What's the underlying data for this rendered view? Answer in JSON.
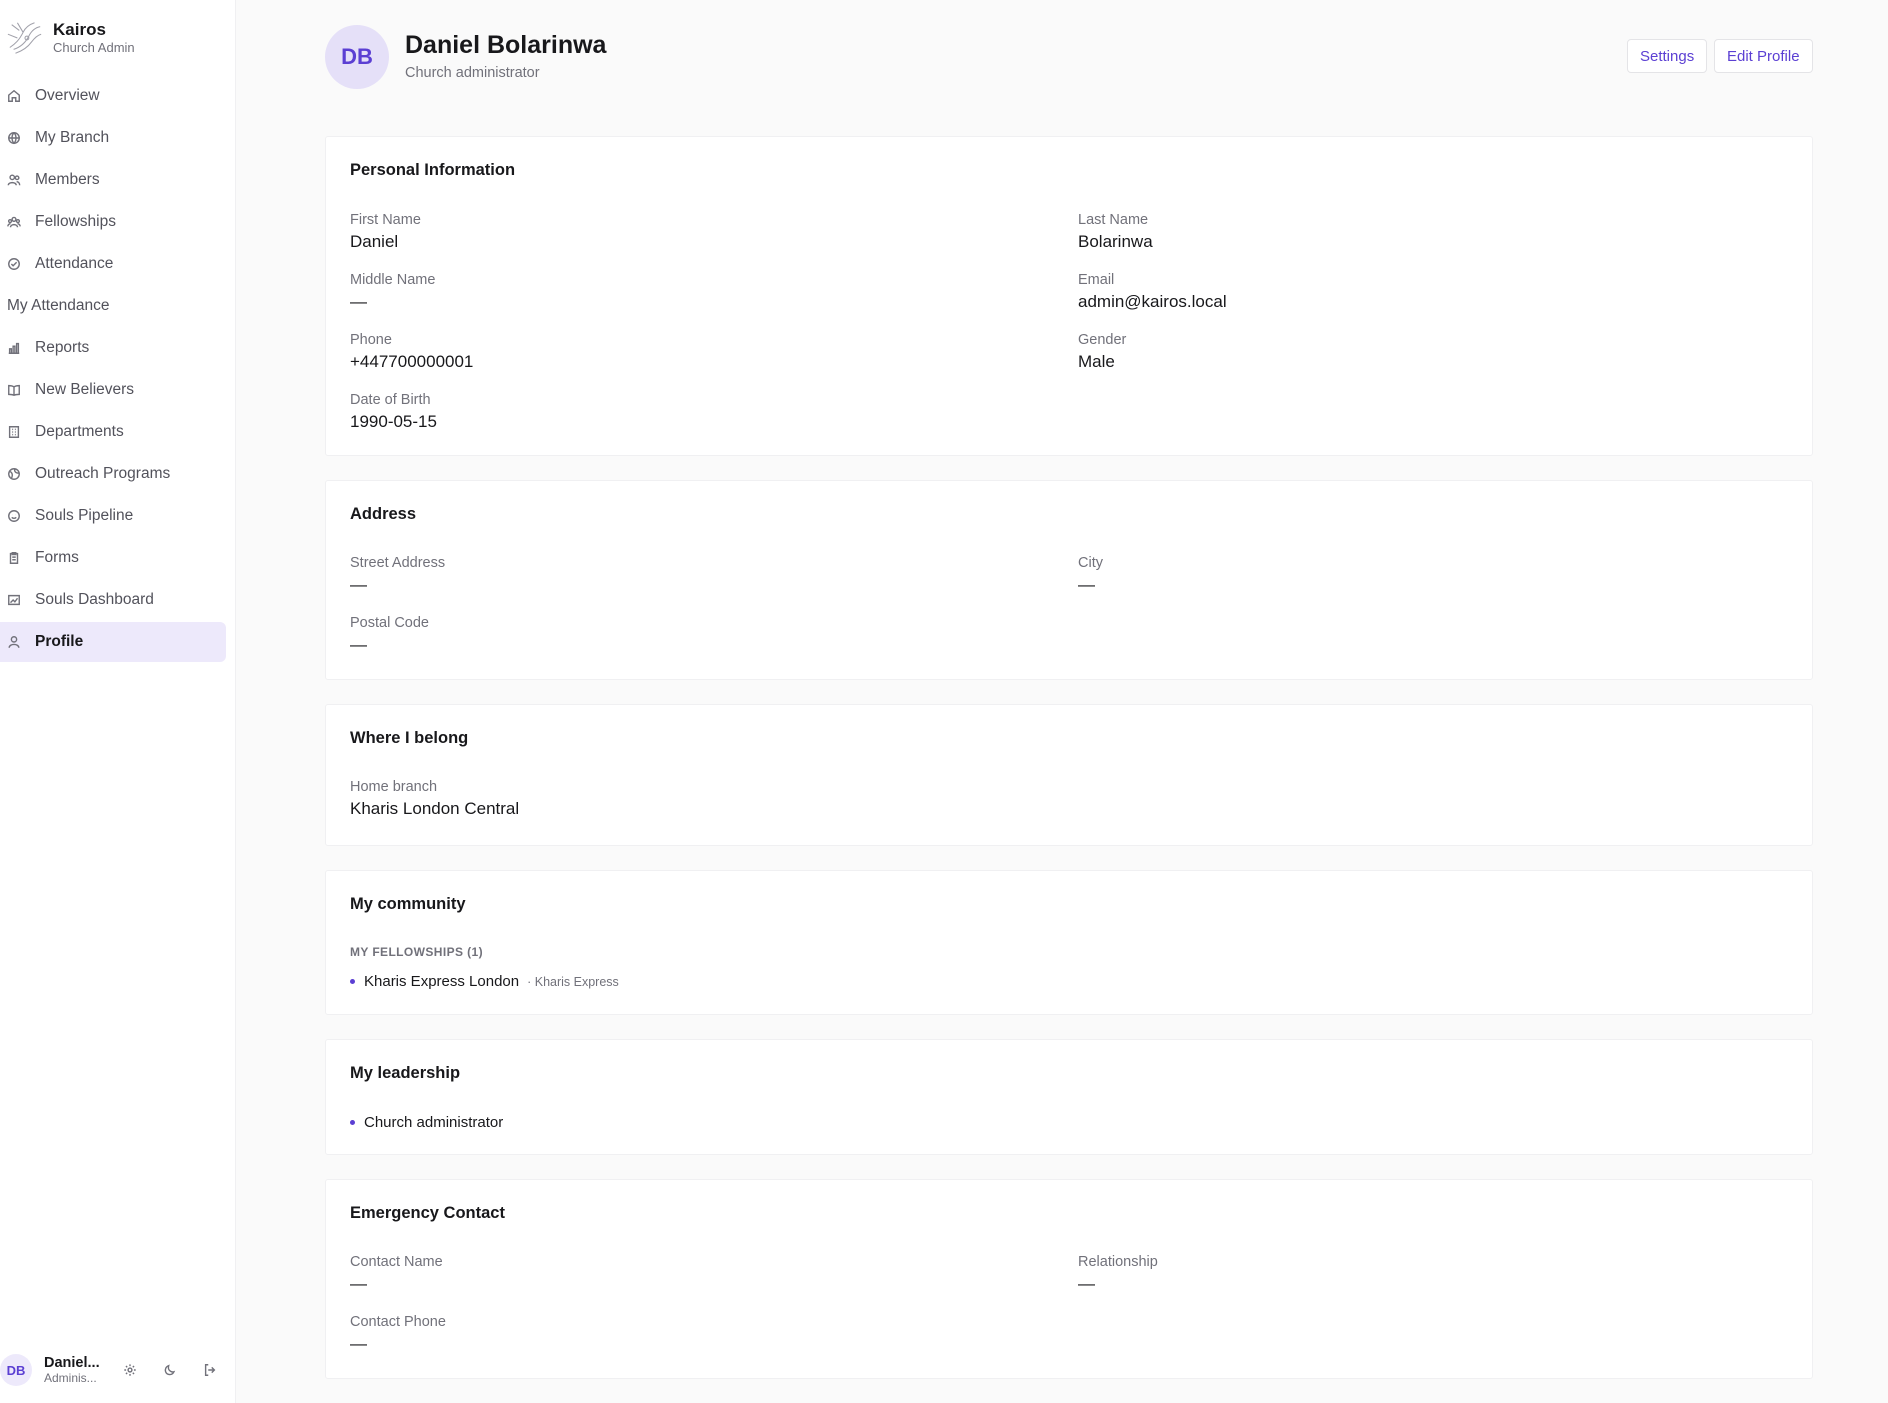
{
  "brand": {
    "name": "Kairos",
    "subtitle": "Church Admin"
  },
  "nav": [
    {
      "label": "Overview",
      "icon": "home-icon"
    },
    {
      "label": "My Branch",
      "icon": "globe-icon"
    },
    {
      "label": "Members",
      "icon": "users-icon"
    },
    {
      "label": "Fellowships",
      "icon": "group-icon"
    },
    {
      "label": "Attendance",
      "icon": "check-circle-icon"
    },
    {
      "label": "My Attendance",
      "icon": ""
    },
    {
      "label": "Reports",
      "icon": "bar-chart-icon"
    },
    {
      "label": "New Believers",
      "icon": "book-icon"
    },
    {
      "label": "Departments",
      "icon": "building-icon"
    },
    {
      "label": "Outreach Programs",
      "icon": "globe-outreach-icon"
    },
    {
      "label": "Souls Pipeline",
      "icon": "smile-icon"
    },
    {
      "label": "Forms",
      "icon": "clipboard-icon"
    },
    {
      "label": "Souls Dashboard",
      "icon": "dashboard-icon"
    },
    {
      "label": "Profile",
      "icon": "user-icon"
    }
  ],
  "active_nav": "Profile",
  "footer": {
    "initials": "DB",
    "name": "Daniel...",
    "role": "Adminis..."
  },
  "header": {
    "initials": "DB",
    "name": "Daniel Bolarinwa",
    "role": "Church administrator",
    "settings_label": "Settings",
    "edit_label": "Edit Profile"
  },
  "personal": {
    "title": "Personal Information",
    "first_name_label": "First Name",
    "first_name": "Daniel",
    "last_name_label": "Last Name",
    "last_name": "Bolarinwa",
    "middle_name_label": "Middle Name",
    "middle_name": "—",
    "email_label": "Email",
    "email": "admin@kairos.local",
    "phone_label": "Phone",
    "phone": "+447700000001",
    "gender_label": "Gender",
    "gender": "Male",
    "dob_label": "Date of Birth",
    "dob": "1990-05-15"
  },
  "address": {
    "title": "Address",
    "street_label": "Street Address",
    "street": "—",
    "city_label": "City",
    "city": "—",
    "postal_label": "Postal Code",
    "postal": "—"
  },
  "belong": {
    "title": "Where I belong",
    "home_branch_label": "Home branch",
    "home_branch": "Kharis London Central"
  },
  "community": {
    "title": "My community",
    "fellowships_header": "MY FELLOWSHIPS (1)",
    "fellowship_name": "Kharis Express London",
    "fellowship_meta": "· Kharis Express"
  },
  "leadership": {
    "title": "My leadership",
    "role": "Church administrator"
  },
  "emergency": {
    "title": "Emergency Contact",
    "contact_name_label": "Contact Name",
    "contact_name": "—",
    "relationship_label": "Relationship",
    "relationship": "—",
    "contact_phone_label": "Contact Phone",
    "contact_phone": "—"
  },
  "colors": {
    "accent": "#5b3fd3",
    "active_bg": "#ede9fb",
    "muted": "#71717a"
  }
}
